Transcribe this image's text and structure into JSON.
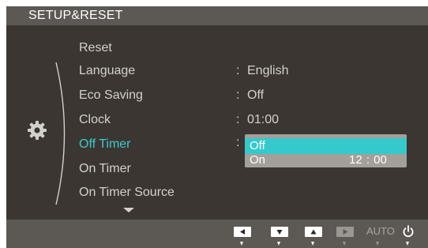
{
  "header": {
    "title": "SETUP&RESET"
  },
  "menu": {
    "items": [
      {
        "label": "Reset",
        "colon": "",
        "value": ""
      },
      {
        "label": "Language",
        "colon": ":",
        "value": "English"
      },
      {
        "label": "Eco Saving",
        "colon": ":",
        "value": "Off"
      },
      {
        "label": "Clock",
        "colon": ":",
        "value": "01:00"
      },
      {
        "label": "Off Timer",
        "colon": ":",
        "value": ""
      },
      {
        "label": "On Timer",
        "colon": "",
        "value": ""
      },
      {
        "label": "On Timer Source",
        "colon": "",
        "value": ""
      }
    ],
    "selected": "Off Timer"
  },
  "dropdown": {
    "options": [
      {
        "label": "Off",
        "time": ""
      },
      {
        "label": "On",
        "time": "12 : 00"
      }
    ],
    "highlighted": "Off"
  },
  "footer": {
    "auto_label": "AUTO",
    "buttons": [
      "left-arrow-icon",
      "down-arrow-icon",
      "up-arrow-icon",
      "enter-icon",
      "auto",
      "power-icon"
    ]
  },
  "colors": {
    "background": "#3b3632",
    "bar": "#5c5853",
    "accent": "#35c9cd",
    "text": "#d4d0cb",
    "dropdown": "#a39f99"
  }
}
